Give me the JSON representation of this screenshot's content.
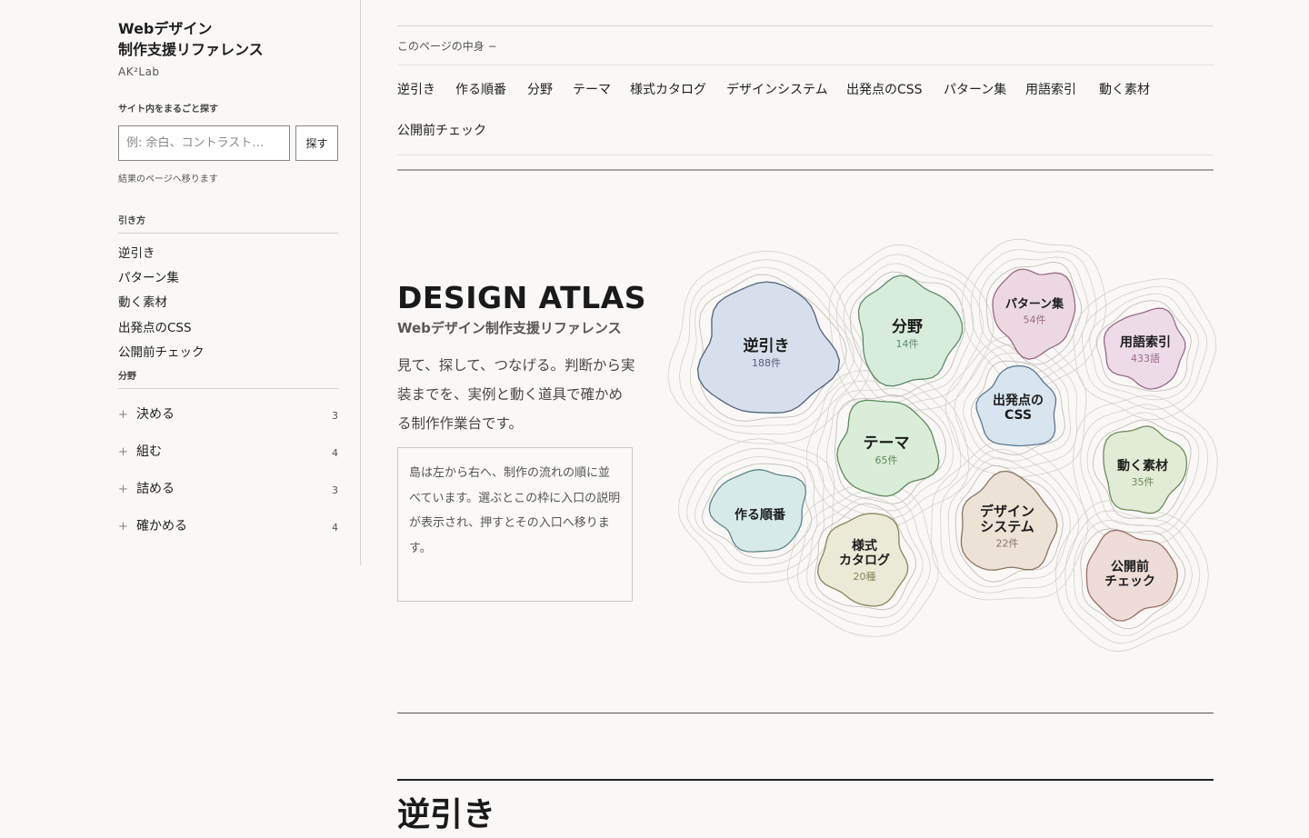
{
  "sidebar": {
    "title_line1": "Webデザイン",
    "title_line2": "制作支援リファレンス",
    "subtitle": "AK²Lab",
    "search": {
      "label": "サイト内をまるごと探す",
      "placeholder": "例: 余白、コントラスト…",
      "button": "探す",
      "hint": "結果のページへ移ります"
    },
    "how_heading": "引き方",
    "how_items": [
      "逆引き",
      "パターン集",
      "動く素材",
      "出発点のCSS",
      "公開前チェック"
    ],
    "field_heading": "分野",
    "field_items": [
      {
        "label": "決める",
        "count": "3"
      },
      {
        "label": "組む",
        "count": "4"
      },
      {
        "label": "詰める",
        "count": "3"
      },
      {
        "label": "確かめる",
        "count": "4"
      }
    ]
  },
  "toc": {
    "label": "このページの中身 −",
    "links": [
      "逆引き",
      "作る順番",
      "分野",
      "テーマ",
      "様式カタログ",
      "デザインシステム",
      "出発点のCSS",
      "パターン集",
      "用語索引",
      "動く素材",
      "公開前チェック"
    ]
  },
  "hero": {
    "title": "DESIGN ATLAS",
    "subtitle": "Webデザイン制作支援リファレンス",
    "text": "見て、探して、つなげる。判断から実装までを、実例と動く道具で確かめる制作作業台です。",
    "info": "島は左から右へ、制作の流れの順に並べています。選ぶとこの枠に入口の説明が表示され、押すとその入口へ移ります。"
  },
  "islands": [
    {
      "key": "reverse",
      "name": "逆引き",
      "count": "188件",
      "fill": "#d6dfeb",
      "stroke": "#55607a"
    },
    {
      "key": "field",
      "name": "分野",
      "count": "14件",
      "fill": "#d8ecdc",
      "stroke": "#5d8a6a"
    },
    {
      "key": "pattern",
      "name": "パターン集",
      "count": "54件",
      "fill": "#ecd8e1",
      "stroke": "#9a6a82"
    },
    {
      "key": "glossary",
      "name": "用語索引",
      "count": "433語",
      "fill": "#eddbe7",
      "stroke": "#9a6a8a"
    },
    {
      "key": "css",
      "name": "出発点の",
      "name2": "CSS",
      "count": "",
      "fill": "#d8e4ee",
      "stroke": "#5c7790"
    },
    {
      "key": "theme",
      "name": "テーマ",
      "count": "65件",
      "fill": "#d9edd9",
      "stroke": "#5c8a5c"
    },
    {
      "key": "motion",
      "name": "動く素材",
      "count": "35件",
      "fill": "#e1ebd5",
      "stroke": "#70895a"
    },
    {
      "key": "order",
      "name": "作る順番",
      "count": "",
      "fill": "#d6eae9",
      "stroke": "#5b8786"
    },
    {
      "key": "catalog",
      "name": "様式",
      "name2": "カタログ",
      "count": "20種",
      "fill": "#ebead6",
      "stroke": "#88855a"
    },
    {
      "key": "system",
      "name": "デザイン",
      "name2": "システム",
      "count": "22件",
      "fill": "#ece2d6",
      "stroke": "#8a7660"
    },
    {
      "key": "check",
      "name": "公開前",
      "name2": "チェック",
      "count": "",
      "fill": "#eddcd8",
      "stroke": "#9a6d66"
    }
  ],
  "section": {
    "title": "逆引き"
  }
}
